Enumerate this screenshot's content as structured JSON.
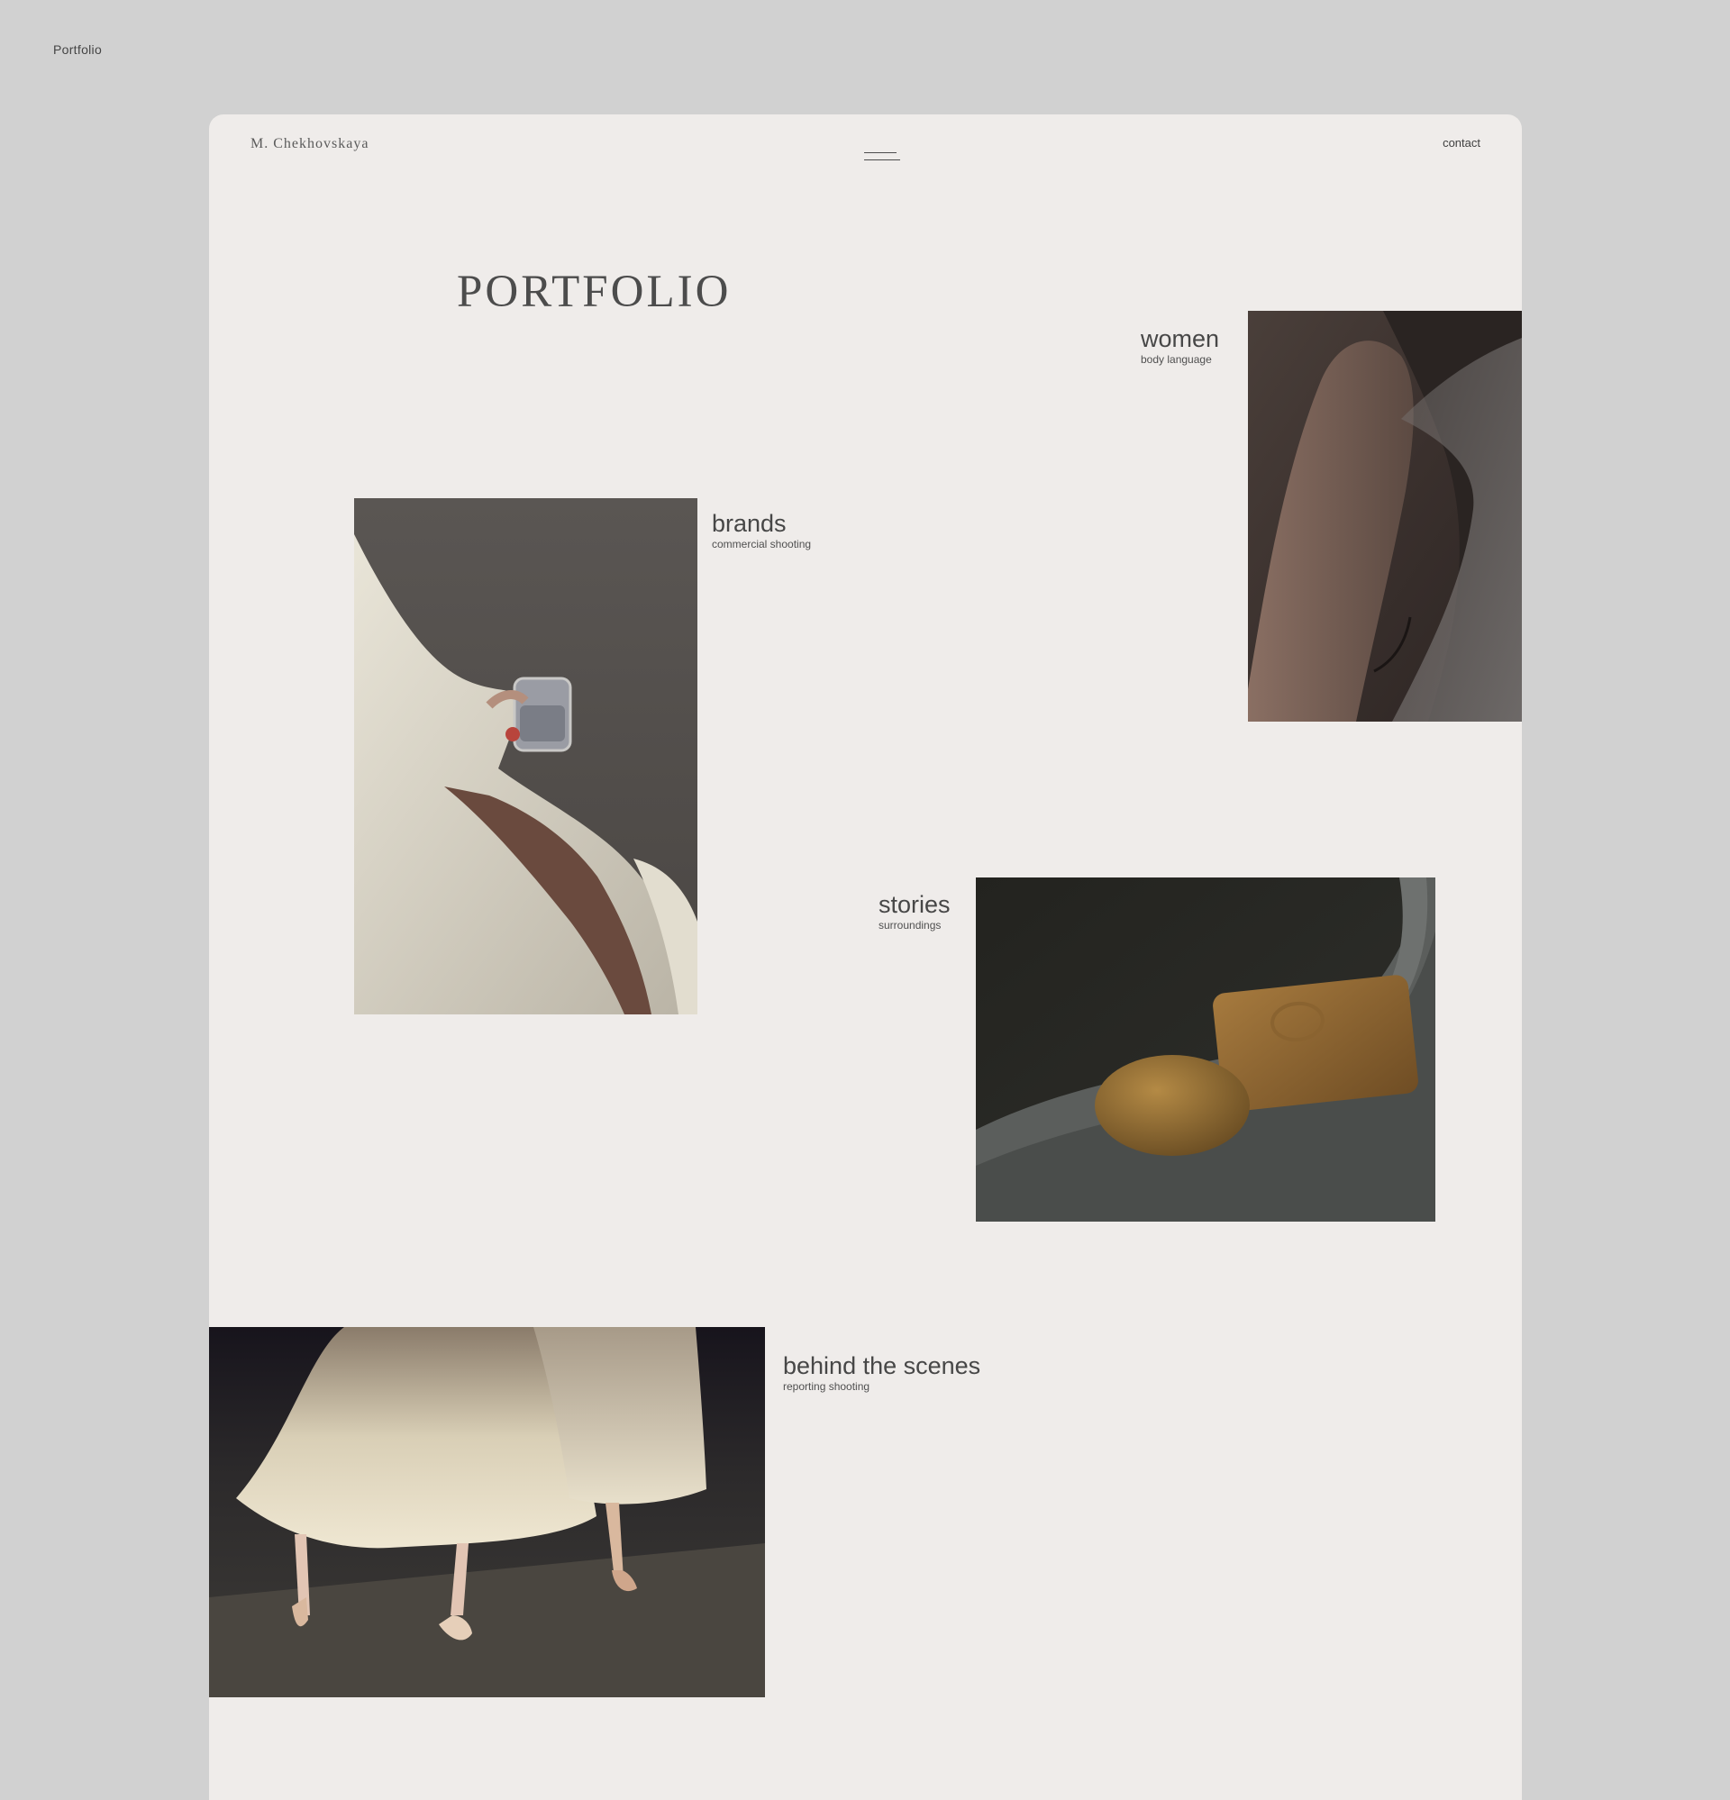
{
  "page_tab_label": "Portfolio",
  "header": {
    "brand": "M. Chekhovskaya",
    "menu_icon": "hamburger-menu-icon",
    "contact_label": "contact"
  },
  "main": {
    "title": "PORTFOLIO",
    "categories": [
      {
        "name": "women",
        "subtitle": "body language"
      },
      {
        "name": "brands",
        "subtitle": "commercial shooting"
      },
      {
        "name": "stories",
        "subtitle": "surroundings"
      },
      {
        "name": "behind the scenes",
        "subtitle": "reporting shooting"
      }
    ]
  },
  "colors": {
    "page_background": "#d1d1d1",
    "frame_background": "#efecea",
    "text": "#3f3f3f"
  }
}
